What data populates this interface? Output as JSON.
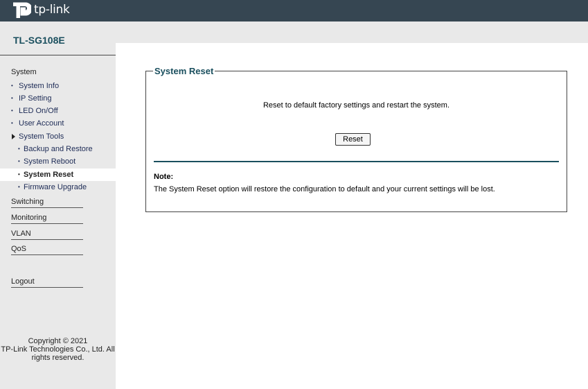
{
  "header": {
    "logo_text": "tp-link",
    "logo_icon": "tp-link-logo-icon"
  },
  "sidebar": {
    "model": "TL-SG108E",
    "section_title": "System",
    "items": [
      {
        "label": "System Info",
        "bullet": "•"
      },
      {
        "label": "IP Setting",
        "bullet": "•"
      },
      {
        "label": "LED On/Off",
        "bullet": "•"
      },
      {
        "label": "User Account",
        "bullet": "•"
      },
      {
        "label": "System Tools",
        "bullet": "triangle-right-icon"
      }
    ],
    "subitems": [
      {
        "label": "Backup and Restore",
        "bullet": "•"
      },
      {
        "label": "System Reboot",
        "bullet": "•"
      },
      {
        "label": "System Reset",
        "bullet": "•",
        "active": true
      },
      {
        "label": "Firmware Upgrade",
        "bullet": "•"
      }
    ],
    "groups": [
      "Switching",
      "Monitoring",
      "VLAN",
      "QoS"
    ],
    "logout": "Logout",
    "copyright": {
      "line1": "Copyright © 2021",
      "line2": "TP-Link Technologies Co., Ltd. All",
      "line3": "rights reserved."
    }
  },
  "main": {
    "panel_title": "System Reset",
    "description": "Reset to default factory settings and restart the system.",
    "reset_button": "Reset",
    "note_label": "Note:",
    "note_text": "The System Reset option will restore the configuration to default and your current settings will be lost."
  },
  "colors": {
    "topbar": "#364652",
    "sidebar_bg": "#e9e9e9",
    "accent": "#1a4f5e"
  }
}
